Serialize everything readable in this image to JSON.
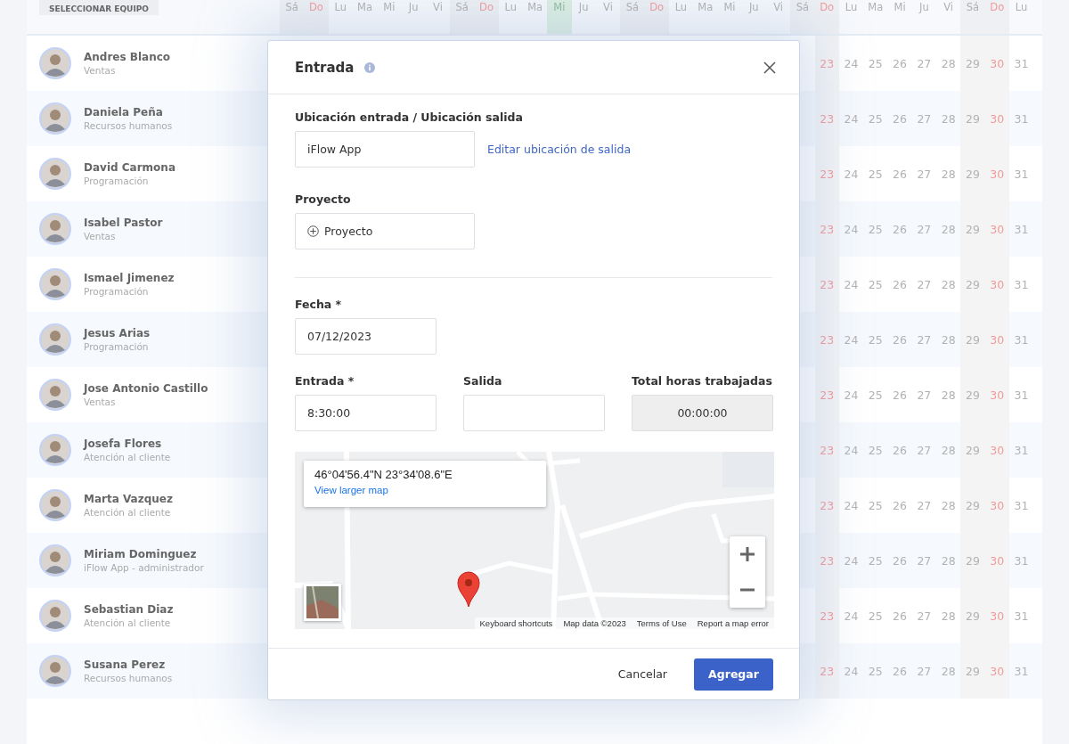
{
  "header": {
    "team_button": "SELECCIONAR EQUIPO"
  },
  "calendar": {
    "days": [
      {
        "label": "Sá",
        "kind": "saturday",
        "today": false
      },
      {
        "label": "Do",
        "kind": "sunday",
        "today": false
      },
      {
        "label": "Lu",
        "kind": "weekday",
        "today": false
      },
      {
        "label": "Ma",
        "kind": "weekday",
        "today": false
      },
      {
        "label": "Mi",
        "kind": "weekday",
        "today": false
      },
      {
        "label": "Ju",
        "kind": "weekday",
        "today": false
      },
      {
        "label": "Vi",
        "kind": "weekday",
        "today": false
      },
      {
        "label": "Sá",
        "kind": "saturday",
        "today": false
      },
      {
        "label": "Do",
        "kind": "sunday",
        "today": false
      },
      {
        "label": "Lu",
        "kind": "weekday",
        "today": false
      },
      {
        "label": "Ma",
        "kind": "weekday",
        "today": false
      },
      {
        "label": "Mi",
        "kind": "weekday",
        "today": true
      },
      {
        "label": "Ju",
        "kind": "weekday",
        "today": false
      },
      {
        "label": "Vi",
        "kind": "weekday",
        "today": false
      },
      {
        "label": "Sá",
        "kind": "saturday",
        "today": false
      },
      {
        "label": "Do",
        "kind": "sunday",
        "today": false
      },
      {
        "label": "Lu",
        "kind": "weekday",
        "today": false
      },
      {
        "label": "Ma",
        "kind": "weekday",
        "today": false
      },
      {
        "label": "Mi",
        "kind": "weekday",
        "today": false
      },
      {
        "label": "Ju",
        "kind": "weekday",
        "today": false
      },
      {
        "label": "Vi",
        "kind": "weekday",
        "today": false
      },
      {
        "label": "Sá",
        "kind": "saturday",
        "today": false
      },
      {
        "label": "Do",
        "kind": "sunday",
        "today": false
      },
      {
        "label": "Lu",
        "kind": "weekday",
        "today": false
      },
      {
        "label": "Ma",
        "kind": "weekday",
        "today": false
      },
      {
        "label": "Mi",
        "kind": "weekday",
        "today": false
      },
      {
        "label": "Ju",
        "kind": "weekday",
        "today": false
      },
      {
        "label": "Vi",
        "kind": "weekday",
        "today": false
      },
      {
        "label": "Sá",
        "kind": "saturday",
        "today": false
      },
      {
        "label": "Do",
        "kind": "sunday",
        "today": false
      },
      {
        "label": "Lu",
        "kind": "weekday",
        "today": false
      }
    ]
  },
  "employees": [
    {
      "name": "Andres Blanco",
      "department": "Ventas",
      "days": [
        "23",
        "24",
        "25",
        "26",
        "27",
        "28",
        "29",
        "30",
        "31"
      ]
    },
    {
      "name": "Daniela Peña",
      "department": "Recursos humanos",
      "days": [
        "23",
        "24",
        "25",
        "26",
        "27",
        "28",
        "29",
        "30",
        "31"
      ]
    },
    {
      "name": "David Carmona",
      "department": "Programación",
      "days": [
        "23",
        "24",
        "25",
        "26",
        "27",
        "28",
        "29",
        "30",
        "31"
      ]
    },
    {
      "name": "Isabel Pastor",
      "department": "Ventas",
      "days": [
        "23",
        "24",
        "25",
        "26",
        "27",
        "28",
        "29",
        "30",
        "31"
      ]
    },
    {
      "name": "Ismael Jimenez",
      "department": "Programación",
      "days": [
        "23",
        "24",
        "25",
        "26",
        "27",
        "28",
        "29",
        "30",
        "31"
      ]
    },
    {
      "name": "Jesus Arias",
      "department": "Programación",
      "days": [
        "23",
        "24",
        "25",
        "26",
        "27",
        "28",
        "29",
        "30",
        "31"
      ]
    },
    {
      "name": "Jose Antonio Castillo",
      "department": "Ventas",
      "days": [
        "23",
        "24",
        "25",
        "26",
        "27",
        "28",
        "29",
        "30",
        "31"
      ]
    },
    {
      "name": "Josefa Flores",
      "department": "Atención al cliente",
      "days": [
        "23",
        "24",
        "25",
        "26",
        "27",
        "28",
        "29",
        "30",
        "31"
      ]
    },
    {
      "name": "Marta Vazquez",
      "department": "Atención al cliente",
      "days": [
        "23",
        "24",
        "25",
        "26",
        "27",
        "28",
        "29",
        "30",
        "31"
      ]
    },
    {
      "name": "Miriam Dominguez",
      "department": "iFlow App - administrador",
      "days": [
        "23",
        "24",
        "25",
        "26",
        "27",
        "28",
        "29",
        "30",
        "31"
      ]
    },
    {
      "name": "Sebastian Diaz",
      "department": "Atención al cliente",
      "days": [
        "23",
        "24",
        "25",
        "26",
        "27",
        "28",
        "29",
        "30",
        "31"
      ]
    },
    {
      "name": "Susana Perez",
      "department": "Recursos humanos",
      "days": [
        "23",
        "24",
        "25",
        "26",
        "27",
        "28",
        "29",
        "30",
        "31"
      ]
    }
  ],
  "dialog": {
    "title": "Entrada",
    "location": {
      "label": "Ubicación entrada / Ubicación salida",
      "value": "iFlow App",
      "link": "Editar ubicación de salida"
    },
    "project": {
      "label": "Proyecto",
      "button": "Proyecto"
    },
    "date": {
      "label": "Fecha *",
      "value": "07/12/2023"
    },
    "times": [
      {
        "label": "Entrada *",
        "value": "8:30:00",
        "readonly": false
      },
      {
        "label": "Salida",
        "readonly": false
      },
      {
        "label": "Total horas trabajadas",
        "value": "00:00:00",
        "readonly": true
      }
    ],
    "map": {
      "kind": "picture",
      "coordinates": "46°04'56.4\"N 23°34'08.6\"E",
      "link": "View larger map",
      "footer": [
        "Keyboard shortcuts",
        "Map data ©2023",
        "Terms of Use",
        "Report a map error"
      ]
    },
    "buttons": {
      "cancel": "Cancelar",
      "submit": "Agregar"
    }
  }
}
